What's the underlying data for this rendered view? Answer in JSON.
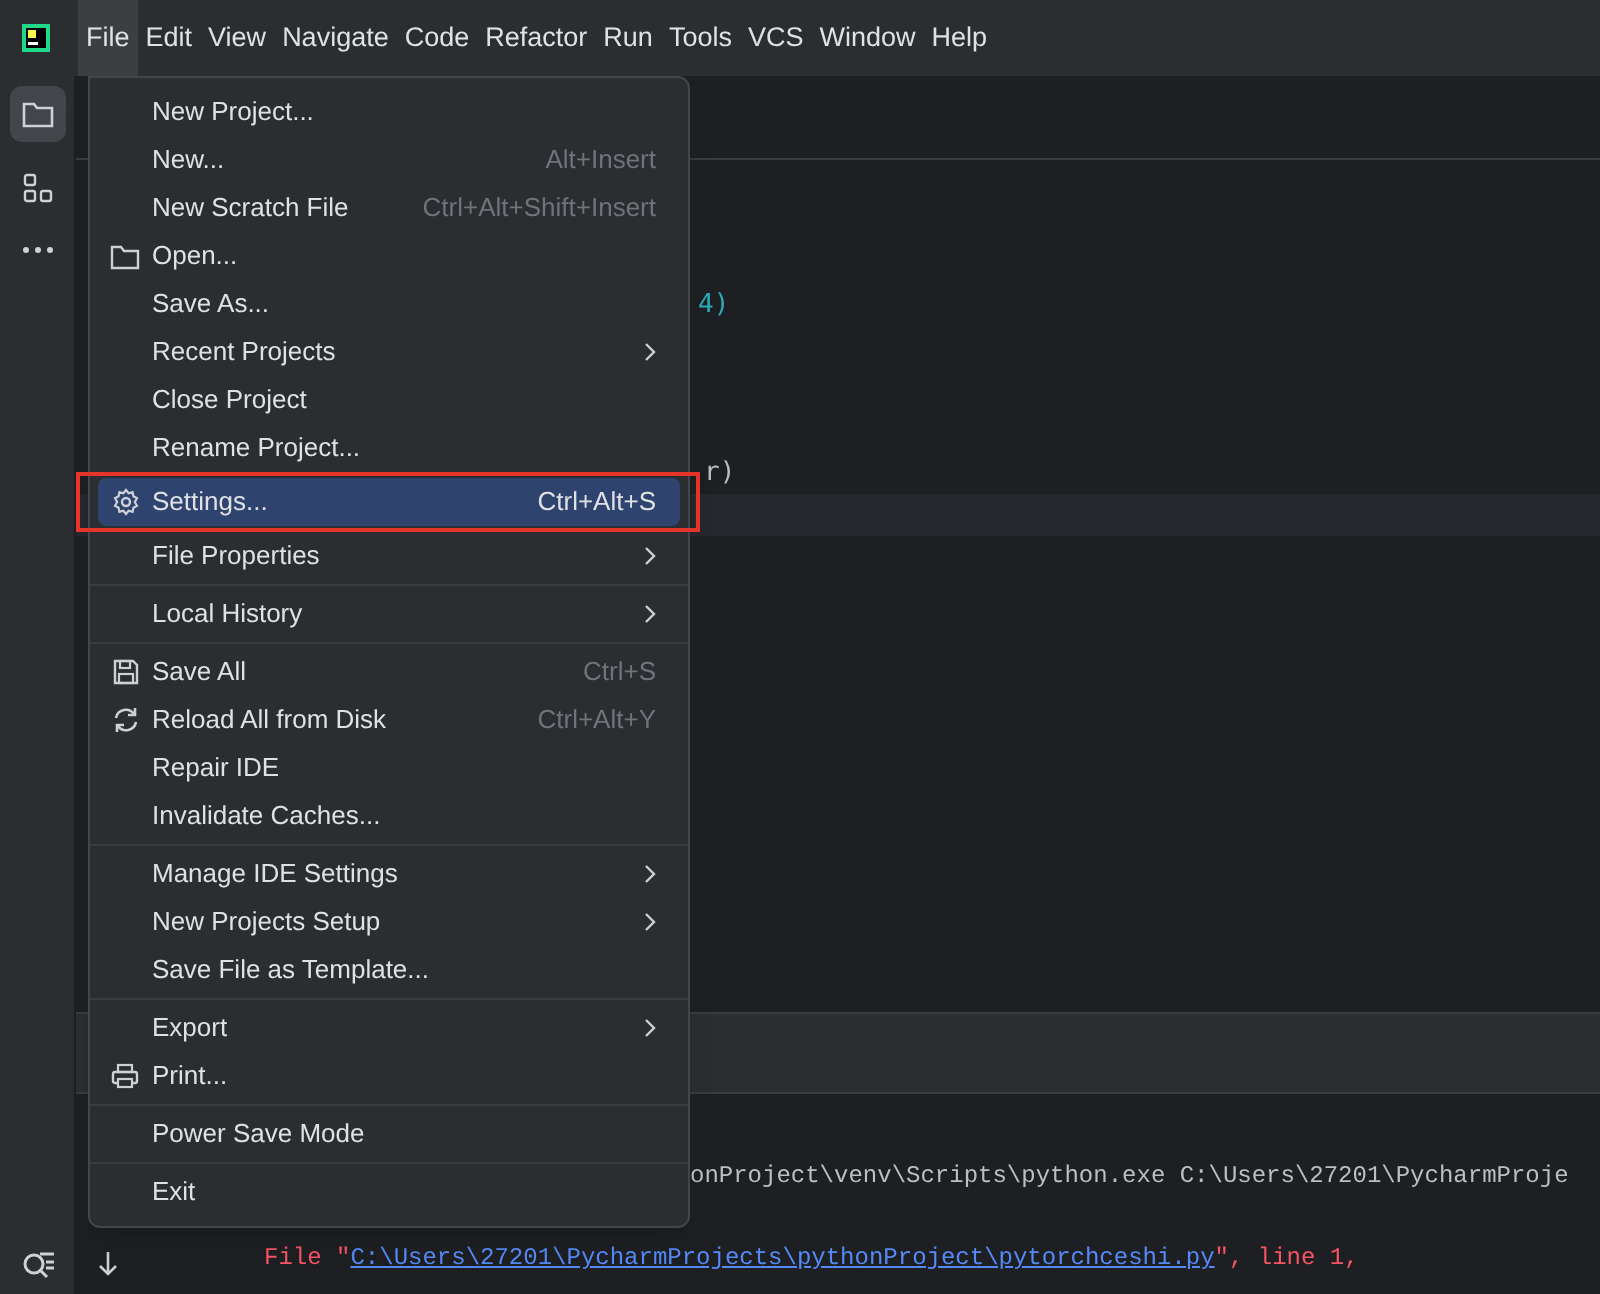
{
  "menu_bar": [
    {
      "label": "File",
      "selected": true
    },
    {
      "label": "Edit",
      "selected": false
    },
    {
      "label": "View",
      "selected": false
    },
    {
      "label": "Navigate",
      "selected": false
    },
    {
      "label": "Code",
      "selected": false
    },
    {
      "label": "Refactor",
      "selected": false
    },
    {
      "label": "Run",
      "selected": false
    },
    {
      "label": "Tools",
      "selected": false
    },
    {
      "label": "VCS",
      "selected": false
    },
    {
      "label": "Window",
      "selected": false
    },
    {
      "label": "Help",
      "selected": false
    }
  ],
  "editor": {
    "code_fragments": [
      {
        "text": "4)",
        "kind": "number"
      },
      {
        "text": "r)",
        "kind": "plain"
      }
    ]
  },
  "console": {
    "lines": [
      [
        {
          "text": "onProject\\venv\\Scripts\\python.exe C:\\Users\\27201\\PycharmProje",
          "kind": "plain"
        }
      ],
      [
        {
          "text": "File \"",
          "kind": "error"
        },
        {
          "text": "C:\\Users\\27201\\PycharmProjects\\pythonProject\\pytorchceshi.py",
          "kind": "link"
        },
        {
          "text": "\", line 1,",
          "kind": "error"
        }
      ]
    ]
  },
  "file_menu": [
    {
      "kind": "item",
      "label": "New Project...",
      "selected": false
    },
    {
      "kind": "item",
      "label": "New...",
      "shortcut": "Alt+Insert",
      "selected": false
    },
    {
      "kind": "item",
      "label": "New Scratch File",
      "shortcut": "Ctrl+Alt+Shift+Insert",
      "selected": false
    },
    {
      "kind": "item",
      "label": "Open...",
      "selected": false
    },
    {
      "kind": "item",
      "label": "Save As...",
      "selected": false
    },
    {
      "kind": "item",
      "label": "Recent Projects",
      "submenu": true,
      "selected": false
    },
    {
      "kind": "item",
      "label": "Close Project",
      "selected": false
    },
    {
      "kind": "item",
      "label": "Rename Project...",
      "selected": false
    },
    {
      "kind": "item",
      "label": "Settings...",
      "shortcut": "Ctrl+Alt+S",
      "selected": true,
      "highlighted": true
    },
    {
      "kind": "item",
      "label": "File Properties",
      "submenu": true,
      "selected": false
    },
    {
      "kind": "separator"
    },
    {
      "kind": "item",
      "label": "Local History",
      "submenu": true,
      "selected": false
    },
    {
      "kind": "separator"
    },
    {
      "kind": "item",
      "label": "Save All",
      "shortcut": "Ctrl+S",
      "selected": false
    },
    {
      "kind": "item",
      "label": "Reload All from Disk",
      "shortcut": "Ctrl+Alt+Y",
      "selected": false
    },
    {
      "kind": "item",
      "label": "Repair IDE",
      "selected": false
    },
    {
      "kind": "item",
      "label": "Invalidate Caches...",
      "selected": false
    },
    {
      "kind": "separator"
    },
    {
      "kind": "item",
      "label": "Manage IDE Settings",
      "submenu": true,
      "selected": false
    },
    {
      "kind": "item",
      "label": "New Projects Setup",
      "submenu": true,
      "selected": false
    },
    {
      "kind": "item",
      "label": "Save File as Template...",
      "selected": false
    },
    {
      "kind": "separator"
    },
    {
      "kind": "item",
      "label": "Export",
      "submenu": true,
      "selected": false
    },
    {
      "kind": "item",
      "label": "Print...",
      "selected": false
    },
    {
      "kind": "separator"
    },
    {
      "kind": "item",
      "label": "Power Save Mode",
      "selected": false
    },
    {
      "kind": "separator"
    },
    {
      "kind": "item",
      "label": "Exit",
      "selected": false
    }
  ]
}
